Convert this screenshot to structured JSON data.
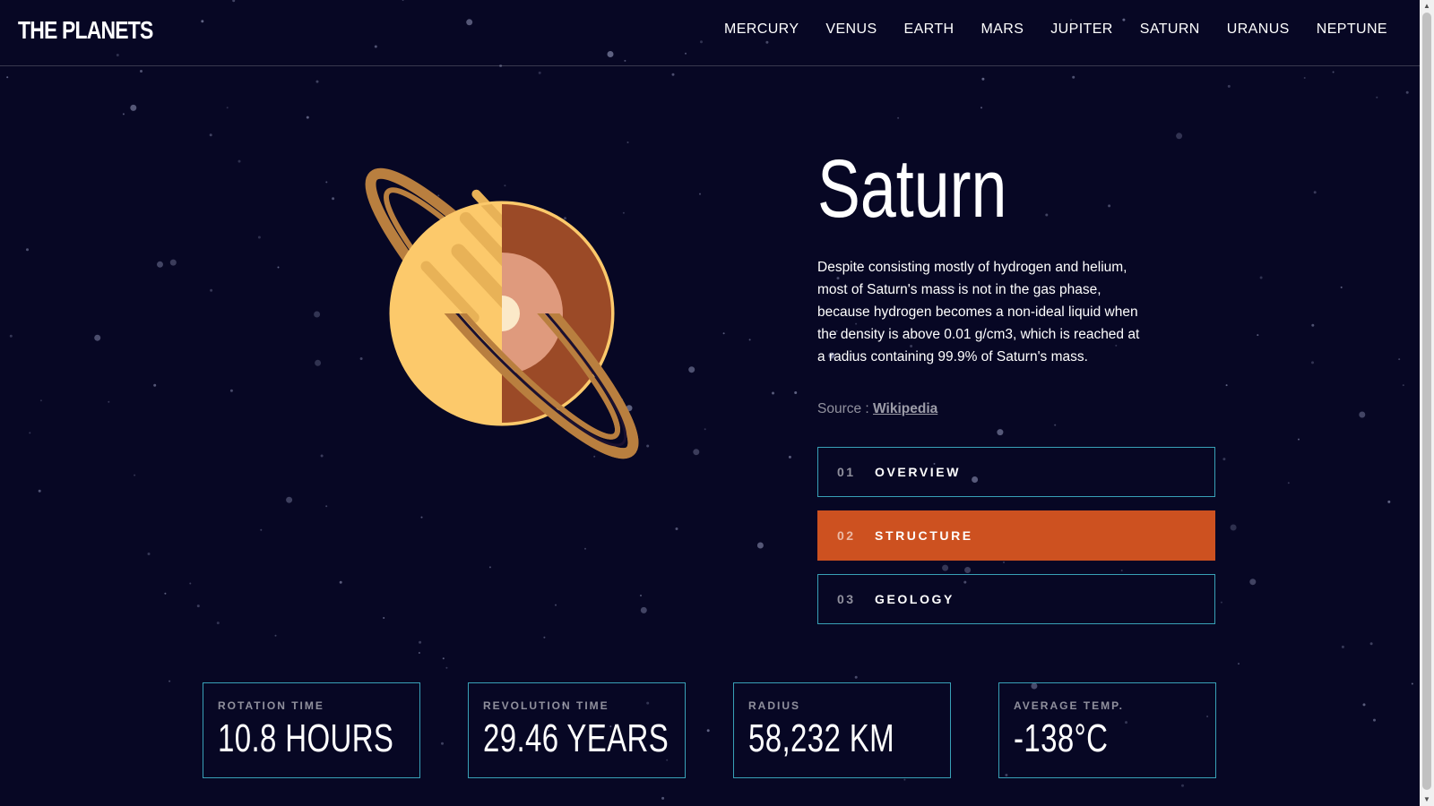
{
  "header": {
    "logo": "THE PLANETS",
    "nav": [
      "MERCURY",
      "VENUS",
      "EARTH",
      "MARS",
      "JUPITER",
      "SATURN",
      "URANUS",
      "NEPTUNE"
    ]
  },
  "planet": {
    "name": "Saturn",
    "description": "Despite consisting mostly of hydrogen and helium, most of Saturn's mass is not in the gas phase, because hydrogen becomes a non-ideal liquid when the density is above 0.01 g/cm3, which is reached at a radius containing 99.9% of Saturn's mass.",
    "source_prefix": "Source : ",
    "source_link": "Wikipedia",
    "image": "saturn-internal-structure-illustration"
  },
  "tabs": [
    {
      "num": "01",
      "label": "OVERVIEW",
      "active": false
    },
    {
      "num": "02",
      "label": "STRUCTURE",
      "active": true
    },
    {
      "num": "03",
      "label": "GEOLOGY",
      "active": false
    }
  ],
  "stats": [
    {
      "label": "ROTATION TIME",
      "value": "10.8 HOURS"
    },
    {
      "label": "REVOLUTION TIME",
      "value": "29.46 YEARS"
    },
    {
      "label": "RADIUS",
      "value": "58,232 KM"
    },
    {
      "label": "AVERAGE TEMP.",
      "value": "-138°C"
    }
  ],
  "colors": {
    "background": "#070724",
    "accent": "#cd5120",
    "border": "#38a0b7",
    "planet_surface": "#fcc96b",
    "planet_mantle": "#9b4a27",
    "planet_core": "#df9a7d",
    "planet_inner_core": "#fbe9c8",
    "rings": "#b97f3f"
  },
  "icons": [
    "scroll-up-arrow-icon",
    "scroll-down-arrow-icon"
  ]
}
